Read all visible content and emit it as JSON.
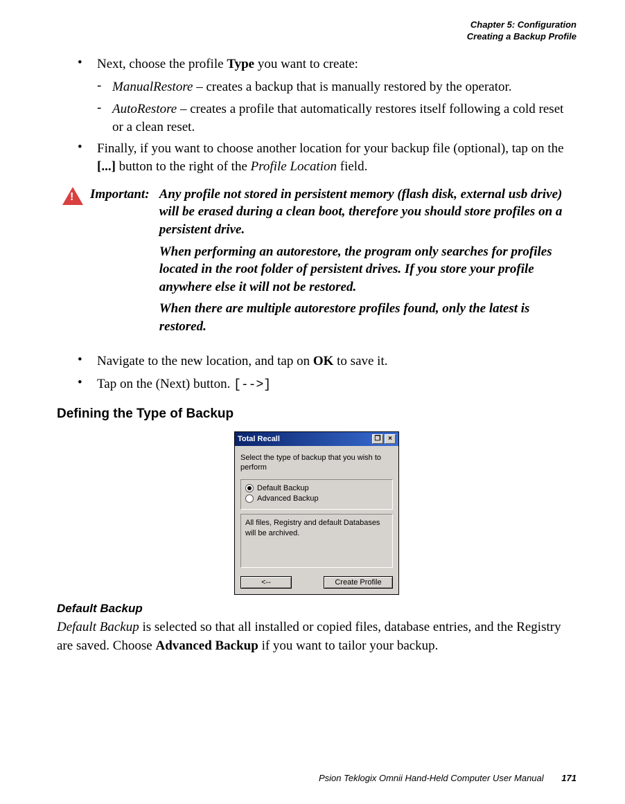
{
  "header": {
    "chapter": "Chapter 5: Configuration",
    "section": "Creating a Backup Profile"
  },
  "body": {
    "bullet1_prefix": "Next, choose the profile ",
    "bullet1_bold": "Type",
    "bullet1_suffix": " you want to create:",
    "sub1_term": "ManualRestore",
    "sub1_text": " – creates a backup that is manually restored by the operator.",
    "sub2_term": "AutoRestore",
    "sub2_text": " – creates a profile that automatically restores itself following a cold reset or a clean reset.",
    "bullet2_prefix": "Finally, if you want to choose another location for your backup file (optional), tap on the ",
    "bullet2_bold": "[...]",
    "bullet2_mid": " button to the right of the ",
    "bullet2_italic": "Profile Location",
    "bullet2_suffix": " field.",
    "important_label": "Important:",
    "important_p1": "Any profile not stored in persistent memory (flash disk, external usb drive) will be erased during a clean boot, therefore you should store profiles on a persistent drive.",
    "important_p2": "When performing an autorestore, the program only searches for profiles located in the root folder of persistent drives. If you store your profile anywhere else it will not be restored.",
    "important_p3": "When there are multiple autorestore profiles found, only the latest is restored.",
    "bullet3_prefix": "Navigate to the new location, and tap on ",
    "bullet3_bold": "OK",
    "bullet3_suffix": " to save it.",
    "bullet4_prefix": "Tap on the (Next) button.  ",
    "bullet4_arrow": "[-->]",
    "heading": "Defining the Type of Backup",
    "subheading": "Default Backup",
    "para_italic": "Default Backup",
    "para_text1": " is selected so that all installed or copied files, database entries, and the Registry are saved. Choose ",
    "para_bold": "Advanced Backup",
    "para_text2": " if you want to tailor your backup."
  },
  "dialog": {
    "title": "Total Recall",
    "prompt": "Select the type of backup that you wish to perform",
    "radio1": "Default Backup",
    "radio2": "Advanced Backup",
    "desc": "All files, Registry and default Databases will be archived.",
    "back": "<--",
    "create": "Create Profile",
    "max_icon": "❐",
    "close_icon": "×"
  },
  "footer": {
    "manual": "Psion Teklogix Omnii Hand-Held Computer User Manual",
    "page": "171"
  }
}
